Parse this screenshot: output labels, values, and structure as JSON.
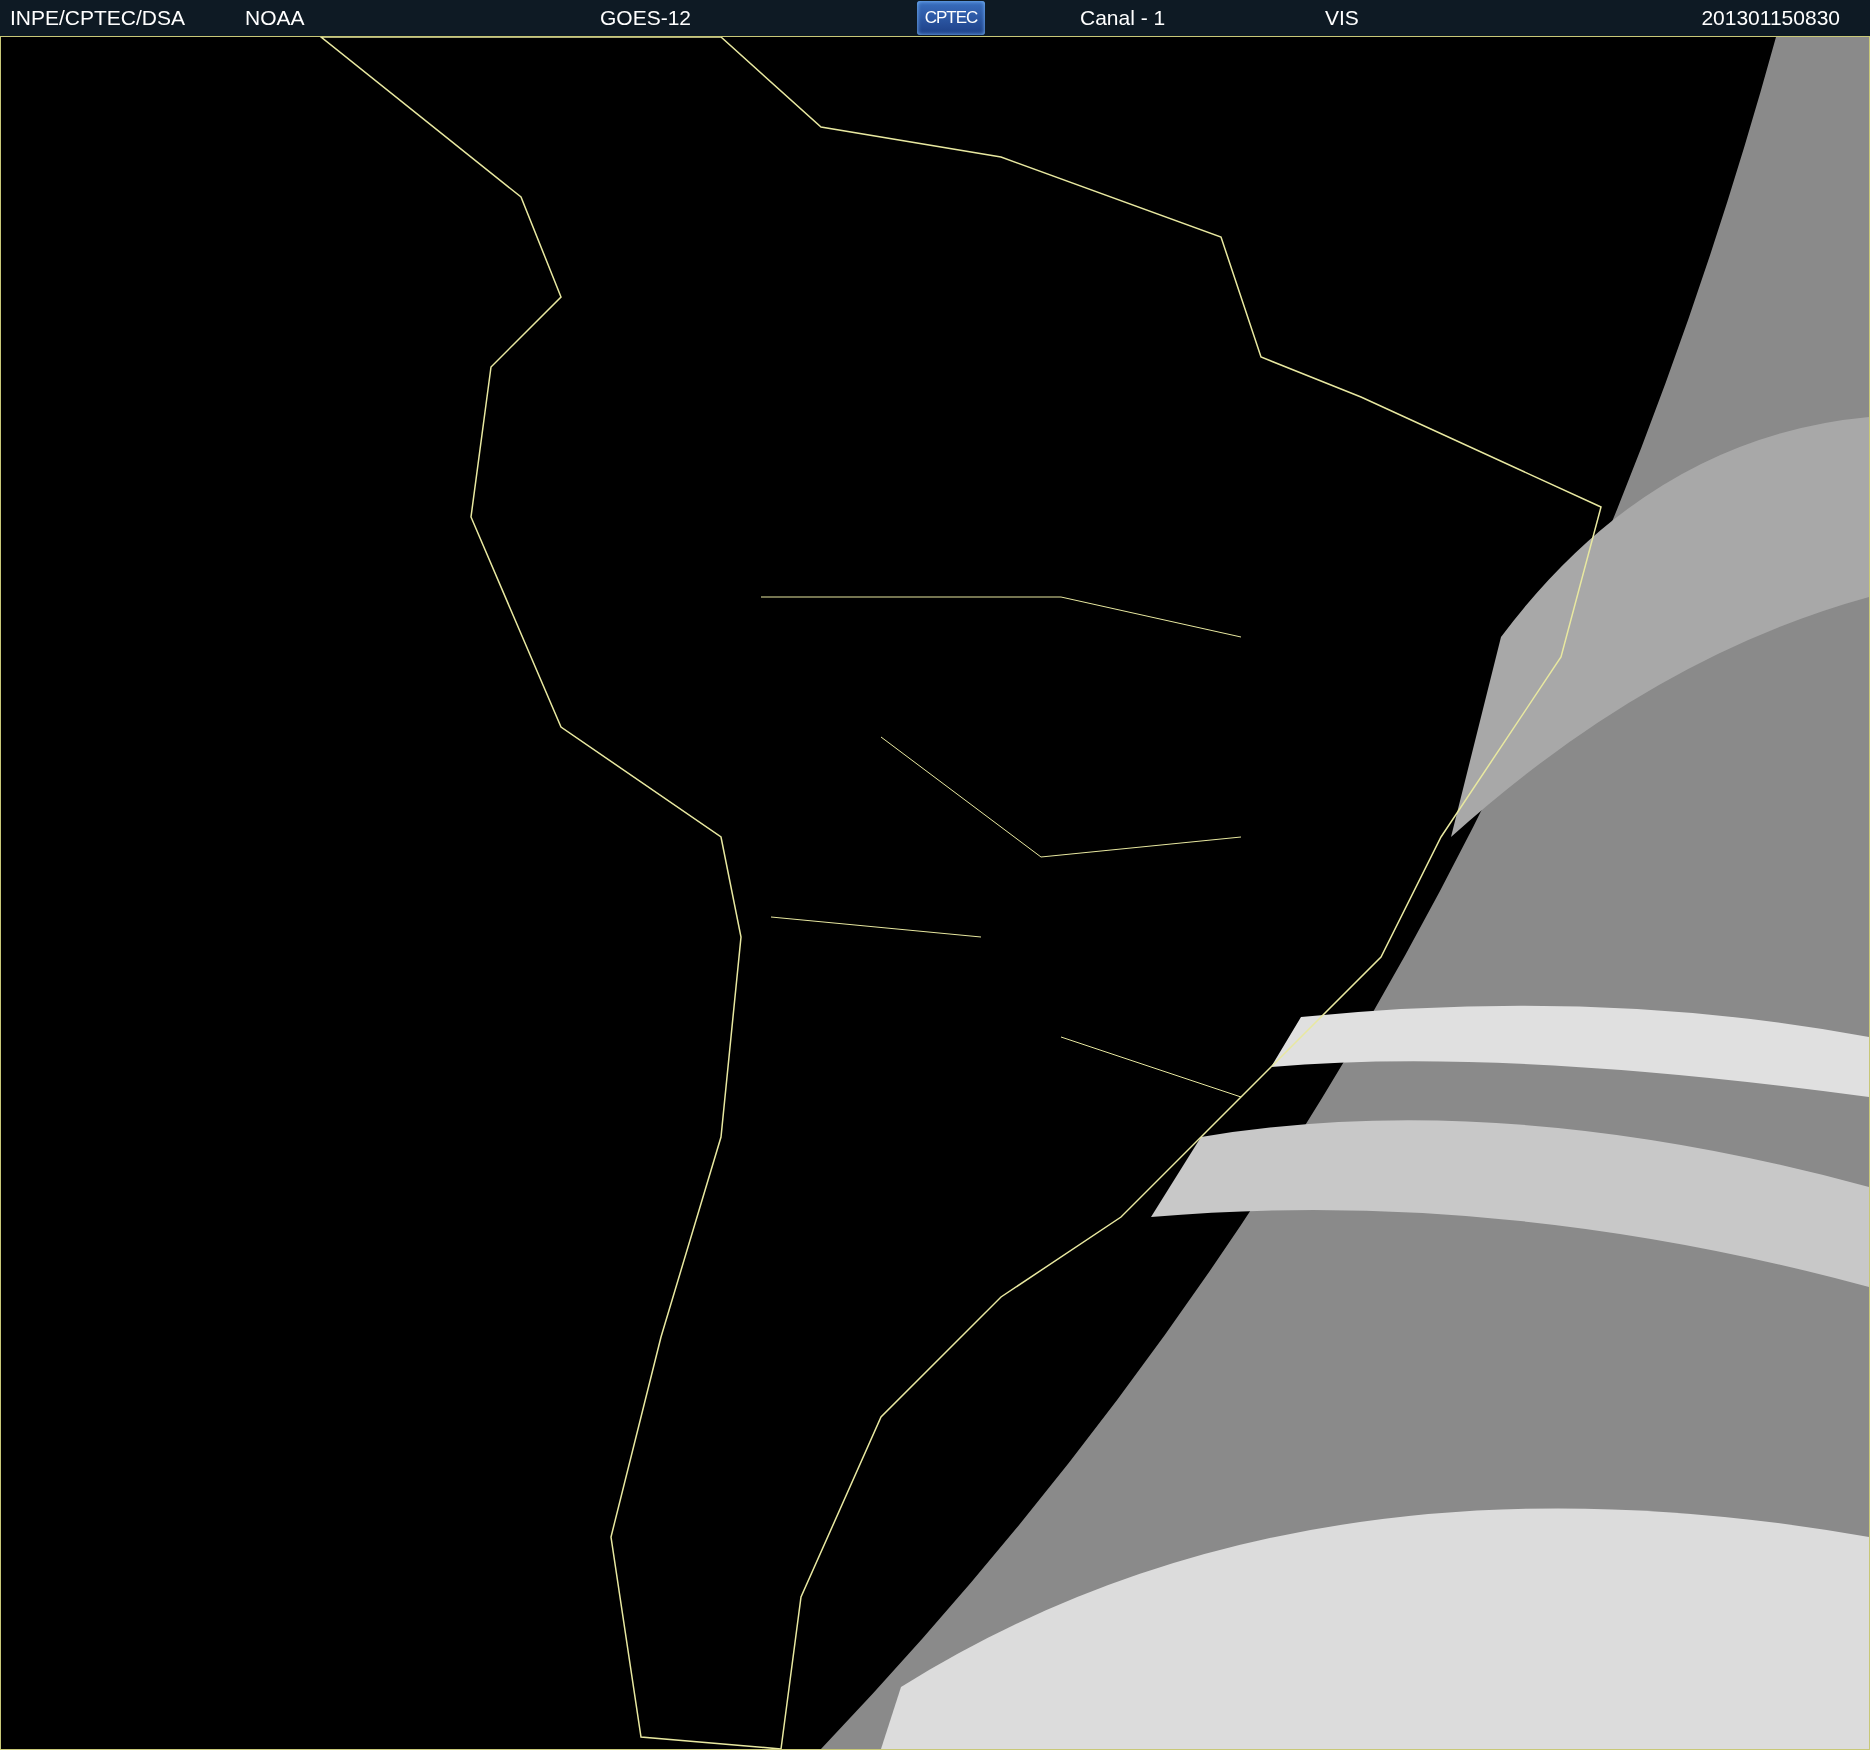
{
  "header": {
    "items": [
      {
        "kind": "text",
        "label": "INPE/CPTEC/DSA"
      },
      {
        "kind": "text",
        "label": "NOAA"
      },
      {
        "kind": "text",
        "label": "GOES-12"
      },
      {
        "kind": "logo",
        "label": "CPTEC"
      },
      {
        "kind": "text",
        "label": "Canal - 1"
      },
      {
        "kind": "text",
        "label": "VIS"
      },
      {
        "kind": "text",
        "label": "201301150830"
      }
    ]
  }
}
